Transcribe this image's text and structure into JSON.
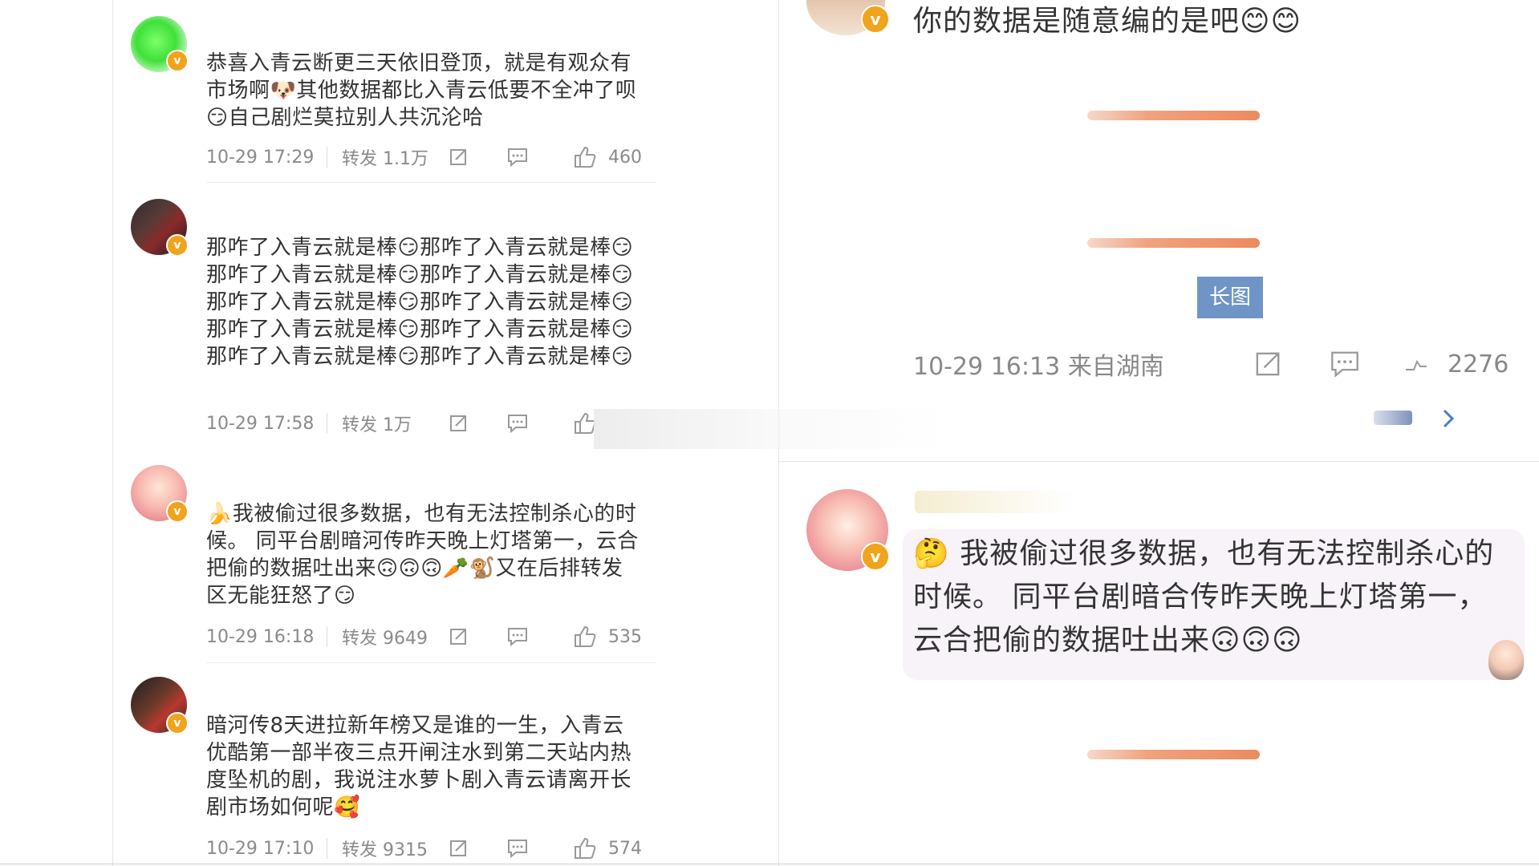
{
  "left": {
    "comments": [
      {
        "text": "恭喜入青云断更三天依旧登顶，就是有观众有市场啊🐶其他数据都比入青云低要不全冲了呗😏自己剧烂莫拉别人共沉沦哈",
        "time": "10-29 17:29",
        "forward": "转发 1.1万",
        "likes": "460"
      },
      {
        "text": "那咋了入青云就是棒😏那咋了入青云就是棒😏那咋了入青云就是棒😏那咋了入青云就是棒😏那咋了入青云就是棒😏那咋了入青云就是棒😏那咋了入青云就是棒😏那咋了入青云就是棒😏那咋了入青云就是棒😏那咋了入青云就是棒😏",
        "time": "10-29 17:58",
        "forward": "转发 1万",
        "likes": ""
      },
      {
        "text": "🍌我被偷过很多数据，也有无法控制杀心的时候。 同平台剧暗河传昨天晚上灯塔第一，云合把偷的数据吐出来🙃🙃🙃🥕🐒又在后排转发区无能狂怒了😏",
        "time": "10-29 16:18",
        "forward": "转发 9649",
        "likes": "535"
      },
      {
        "text": "暗河传8天进拉新年榜又是谁的一生，入青云优酷第一部半夜三点开闸注水到第二天站内热度坠机的剧，我说注水萝卜剧入青云请离开长剧市场如何呢🥰",
        "time": "10-29 17:10",
        "forward": "转发 9315",
        "likes": "574"
      }
    ]
  },
  "right": {
    "top_text": "你的数据是随意编的是吧😊😊",
    "long_image_label": "长图",
    "time_source": "10-29 16:13 来自湖南",
    "likes": "2276",
    "reply_text": "🤔 我被偷过很多数据，也有无法控制杀心的时候。 同平台剧暗合传昨天晚上灯塔第一，云合把偷的数据吐出来🙃🙃🙃"
  },
  "colors": {
    "badge": "#f0a31c",
    "long_image_bg": "#6f95c7",
    "bar_orange": "#ec8a5f",
    "meta_gray": "#8a8a8a"
  },
  "icons": [
    "share-icon",
    "comment-icon",
    "like-icon",
    "chevron-right-icon",
    "verified-badge-icon"
  ]
}
